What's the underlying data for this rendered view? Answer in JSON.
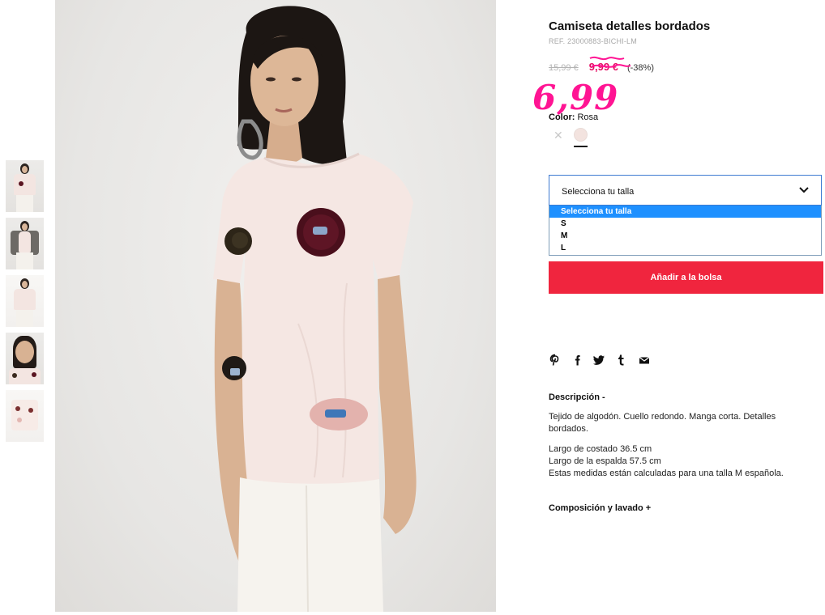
{
  "product": {
    "title": "Camiseta detalles bordados",
    "ref": "REF. 23000883-BICHI-LM",
    "old_price": "15,99 €",
    "sale_price": "9,99 €",
    "discount": "(-38%)",
    "handwritten_price": "6,99",
    "color_label": "Color:",
    "color_value": "Rosa",
    "colors": {
      "sale": "#e50a61",
      "handwritten": "#ff1493",
      "button": "#f0253e",
      "selected_option": "#1e90ff"
    }
  },
  "size_select": {
    "label": "Selecciona tu talla",
    "options": [
      "Selecciona tu talla",
      "S",
      "M",
      "L"
    ],
    "selected_index": 0
  },
  "add_to_bag": "Añadir a la bolsa",
  "share_icons": [
    "pinterest-icon",
    "facebook-icon",
    "twitter-icon",
    "tumblr-icon",
    "mail-icon"
  ],
  "description": {
    "title": "Descripción -",
    "paragraph": "Tejido de algodón. Cuello redondo. Manga corta. Detalles bordados.",
    "lines": [
      "Largo de costado 36.5 cm",
      "Largo de la espalda 57.5 cm",
      "Estas medidas están calculadas para una talla M española."
    ]
  },
  "composition_title": "Composición y lavado +"
}
